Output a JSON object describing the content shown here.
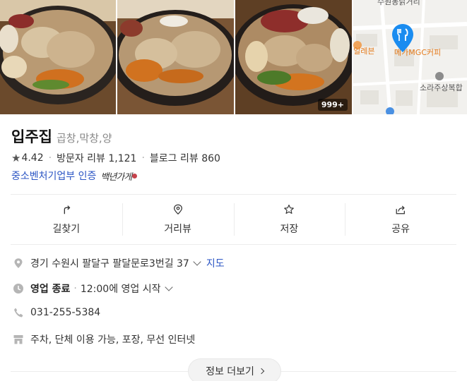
{
  "photos": {
    "count_badge": "999+"
  },
  "map": {
    "labels": [
      "수원동닭거리",
      "본일레븐",
      "메가MGC커피",
      "소라주상복합"
    ],
    "pin_icon": "restaurant-pin-icon"
  },
  "place": {
    "name": "입주집",
    "category": "곱창,막창,양"
  },
  "rating": {
    "score": "4.42",
    "visitor_reviews": "방문자 리뷰 1,121",
    "blog_reviews": "블로그 리뷰 860"
  },
  "certification": {
    "label": "중소벤처기업부 인증",
    "signature_text": "백년가게"
  },
  "actions": [
    {
      "label": "길찾기",
      "icon": "directions-icon"
    },
    {
      "label": "거리뷰",
      "icon": "location-pin-icon"
    },
    {
      "label": "저장",
      "icon": "star-icon"
    },
    {
      "label": "공유",
      "icon": "share-icon"
    }
  ],
  "info": {
    "address": "경기 수원시 팔달구 팔달문로3번길 37",
    "map_link": "지도",
    "status": "영업 종료",
    "open_time": "12:00에 영업 시작",
    "phone": "031-255-5384",
    "amenities": "주차, 단체 이용 가능, 포장, 무선 인터넷"
  },
  "more_button": "정보 더보기",
  "colors": {
    "link": "#2b55c4",
    "pin": "#1a8cf0",
    "badge_bg": "#000000"
  }
}
